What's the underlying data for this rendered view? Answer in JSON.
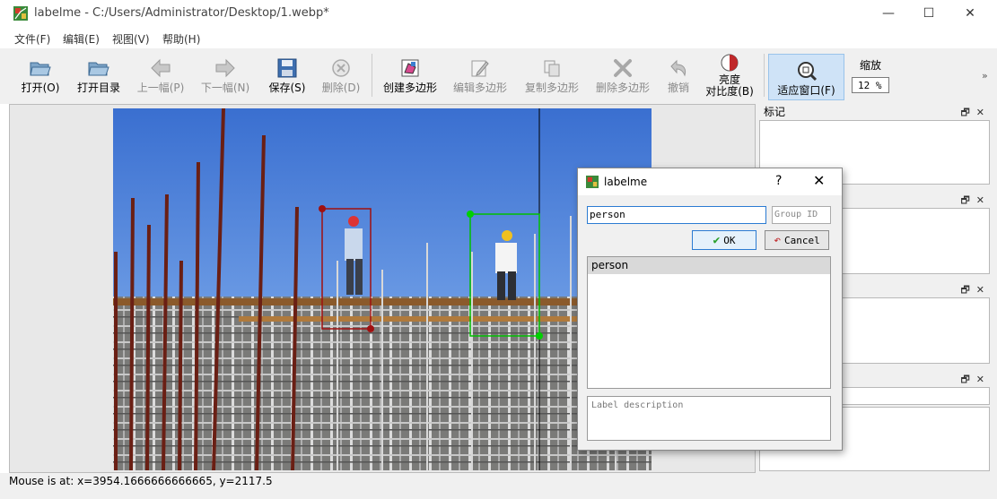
{
  "window": {
    "app_name": "labelme",
    "title": "labelme - C:/Users/Administrator/Desktop/1.webp*",
    "controls": {
      "minimize": "—",
      "maximize": "☐",
      "close": "✕"
    }
  },
  "menu": [
    "文件(F)",
    "编辑(E)",
    "视图(V)",
    "帮助(H)"
  ],
  "toolbar": {
    "open": "打开(O)",
    "open_dir": "打开目录",
    "prev": "上一幅(P)",
    "next": "下一幅(N)",
    "save": "保存(S)",
    "delete_file": "删除(D)",
    "create_polygon": "创建多边形",
    "edit_polygon": "编辑多边形",
    "copy_polygon": "复制多边形",
    "delete_polygon": "删除多边形",
    "undo": "撤销",
    "brightness_line1": "亮度",
    "brightness_line2": "对比度(B)",
    "fit_window": "适应窗口(F)",
    "zoom_label": "缩放",
    "zoom_value": "12 %",
    "more": "»"
  },
  "docks": [
    {
      "title": "标记"
    },
    {
      "title": ""
    },
    {
      "title": ""
    },
    {
      "title": ""
    }
  ],
  "dock_controls": {
    "float": "🗗",
    "close": "✕"
  },
  "status": {
    "mouse": "Mouse is at: x=3954.1666666666665, y=2117.5"
  },
  "dialog": {
    "title": "labelme",
    "help": "?",
    "close": "✕",
    "label_value": "person",
    "group_id_placeholder": "Group ID",
    "ok": "OK",
    "cancel": "Cancel",
    "labels": [
      "person"
    ],
    "description_placeholder": "Label description"
  },
  "colors": {
    "box_person_1": "#a01010",
    "box_person_2": "#00c000",
    "active_tool": "#cfe3f7",
    "dialog_focus": "#2b7bd2"
  }
}
